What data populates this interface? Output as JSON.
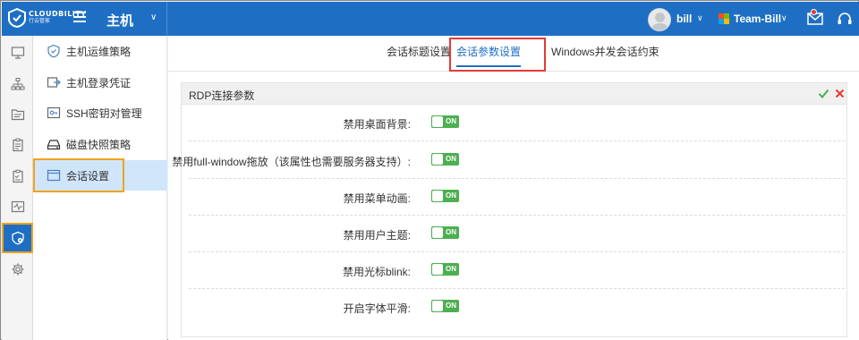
{
  "brand": {
    "name": "CLOUDBILITY",
    "sub": "行云管家"
  },
  "header": {
    "title": "主机",
    "user": "bill",
    "team": "Team-Bill"
  },
  "submenu": [
    {
      "label": "主机运维策略",
      "icon": "shield-check-icon"
    },
    {
      "label": "主机登录凭证",
      "icon": "login-credential-icon"
    },
    {
      "label": "SSH密钥对管理",
      "icon": "key-card-icon"
    },
    {
      "label": "磁盘快照策略",
      "icon": "disk-snapshot-icon"
    },
    {
      "label": "会话设置",
      "icon": "session-window-icon"
    }
  ],
  "tabs": [
    {
      "label": "会话标题设置"
    },
    {
      "label": "会话参数设置"
    },
    {
      "label": "Windows并发会话约束"
    }
  ],
  "panel": {
    "title": "RDP连接参数",
    "rows": [
      {
        "label": "禁用桌面背景:",
        "state": "ON"
      },
      {
        "label": "禁用full-window拖放（该属性也需要服务器支持）:",
        "state": "ON"
      },
      {
        "label": "禁用菜单动画:",
        "state": "ON"
      },
      {
        "label": "禁用用户主题:",
        "state": "ON"
      },
      {
        "label": "禁用光标blink:",
        "state": "ON"
      },
      {
        "label": "开启字体平滑:",
        "state": "ON"
      }
    ]
  },
  "colors": {
    "primary": "#1e6fc4",
    "toggle_on": "#4caf50",
    "highlight_orange": "#f0a31a",
    "highlight_red": "#e53935"
  }
}
